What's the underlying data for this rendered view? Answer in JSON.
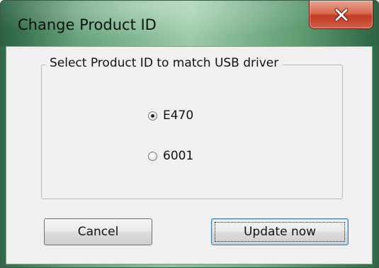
{
  "window": {
    "title": "Change Product ID"
  },
  "titlebar": {
    "close_icon": "close-icon"
  },
  "group": {
    "legend": "Select Product ID to match USB driver",
    "options": [
      {
        "label": "E470",
        "selected": true
      },
      {
        "label": "6001",
        "selected": false
      }
    ]
  },
  "buttons": {
    "cancel": "Cancel",
    "update": "Update now"
  }
}
